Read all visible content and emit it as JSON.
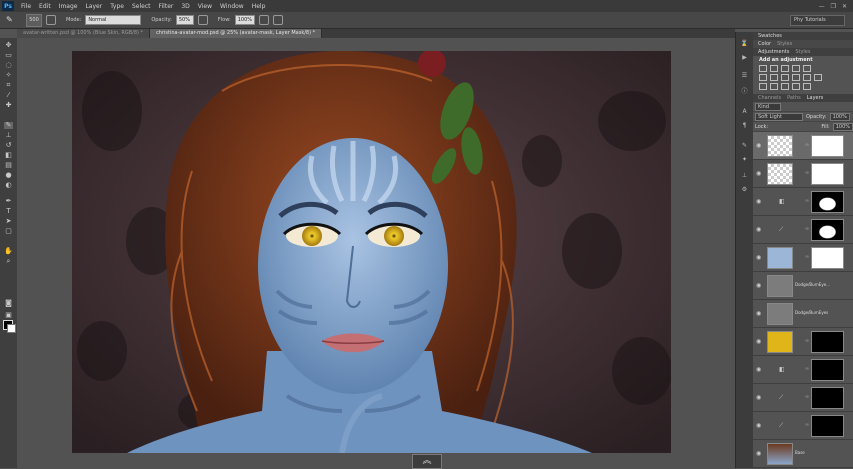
{
  "app": {
    "logo": "Ps"
  },
  "menu": [
    "File",
    "Edit",
    "Image",
    "Layer",
    "Type",
    "Select",
    "Filter",
    "3D",
    "View",
    "Window",
    "Help"
  ],
  "window_controls": [
    "—",
    "❐",
    "✕"
  ],
  "options": {
    "brush_size": "500",
    "mode_label": "Mode:",
    "mode_value": "Normal",
    "opacity_label": "Opacity:",
    "opacity_value": "50%",
    "flow_label": "Flow:",
    "flow_value": "100%",
    "workspace": "Phy Tutorials"
  },
  "tabs": [
    {
      "label": "avatar-written.psd @ 100% (Blue Skin, RGB/8) *"
    },
    {
      "label": "christina-avatar-mod.psd @ 25% (avatar-mask, Layer Mask/8) *"
    }
  ],
  "panels": {
    "swatches": "Swatches",
    "color_tabs": [
      "Color",
      "Styles"
    ],
    "adjustments_tabs": [
      "Adjustments",
      "Styles"
    ],
    "add_adjustment": "Add an adjustment",
    "layers_tabs": [
      "Channels",
      "Paths",
      "Layers"
    ],
    "kind_label": "Kind",
    "blend_mode": "Soft Light",
    "opacity_label": "Opacity:",
    "opacity_value": "100%",
    "lock_label": "Lock:",
    "fill_label": "Fill:",
    "fill_value": "100%"
  },
  "layers": [
    {
      "name": ""
    },
    {
      "name": ""
    },
    {
      "name": ""
    },
    {
      "name": ""
    },
    {
      "name": ""
    },
    {
      "name": "Dodge/BurnEye..."
    },
    {
      "name": "Dodge/BurnEyes"
    },
    {
      "name": ""
    },
    {
      "name": ""
    },
    {
      "name": ""
    },
    {
      "name": ""
    },
    {
      "name": "Base"
    }
  ],
  "colors": {
    "chrome_dark": "#3a3a3a",
    "panel": "#535353",
    "skin": "#7ea0c8",
    "iris": "#e0b51a"
  }
}
